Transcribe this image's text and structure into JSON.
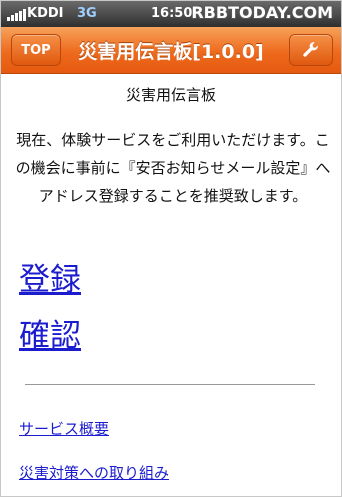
{
  "watermark": "RBBTODAY.COM",
  "status_bar": {
    "carrier": "KDDI",
    "network": "3G",
    "time": "16:50"
  },
  "nav": {
    "top_label": "TOP",
    "title": "災害用伝言板[1.0.0]",
    "settings_icon": "wrench-icon"
  },
  "main": {
    "heading": "災害用伝言板",
    "notice": "現在、体験サービスをご利用いただけます。この機会に事前に『安否お知らせメール設定』へアドレス登録することを推奨致します。",
    "links": {
      "register": "登録",
      "confirm": "確認",
      "service_overview": "サービス概要",
      "disaster_measures": "災害対策への取り組み"
    }
  },
  "colors": {
    "nav_orange": "#ee6a1c",
    "link_blue": "#1c1ccf"
  }
}
